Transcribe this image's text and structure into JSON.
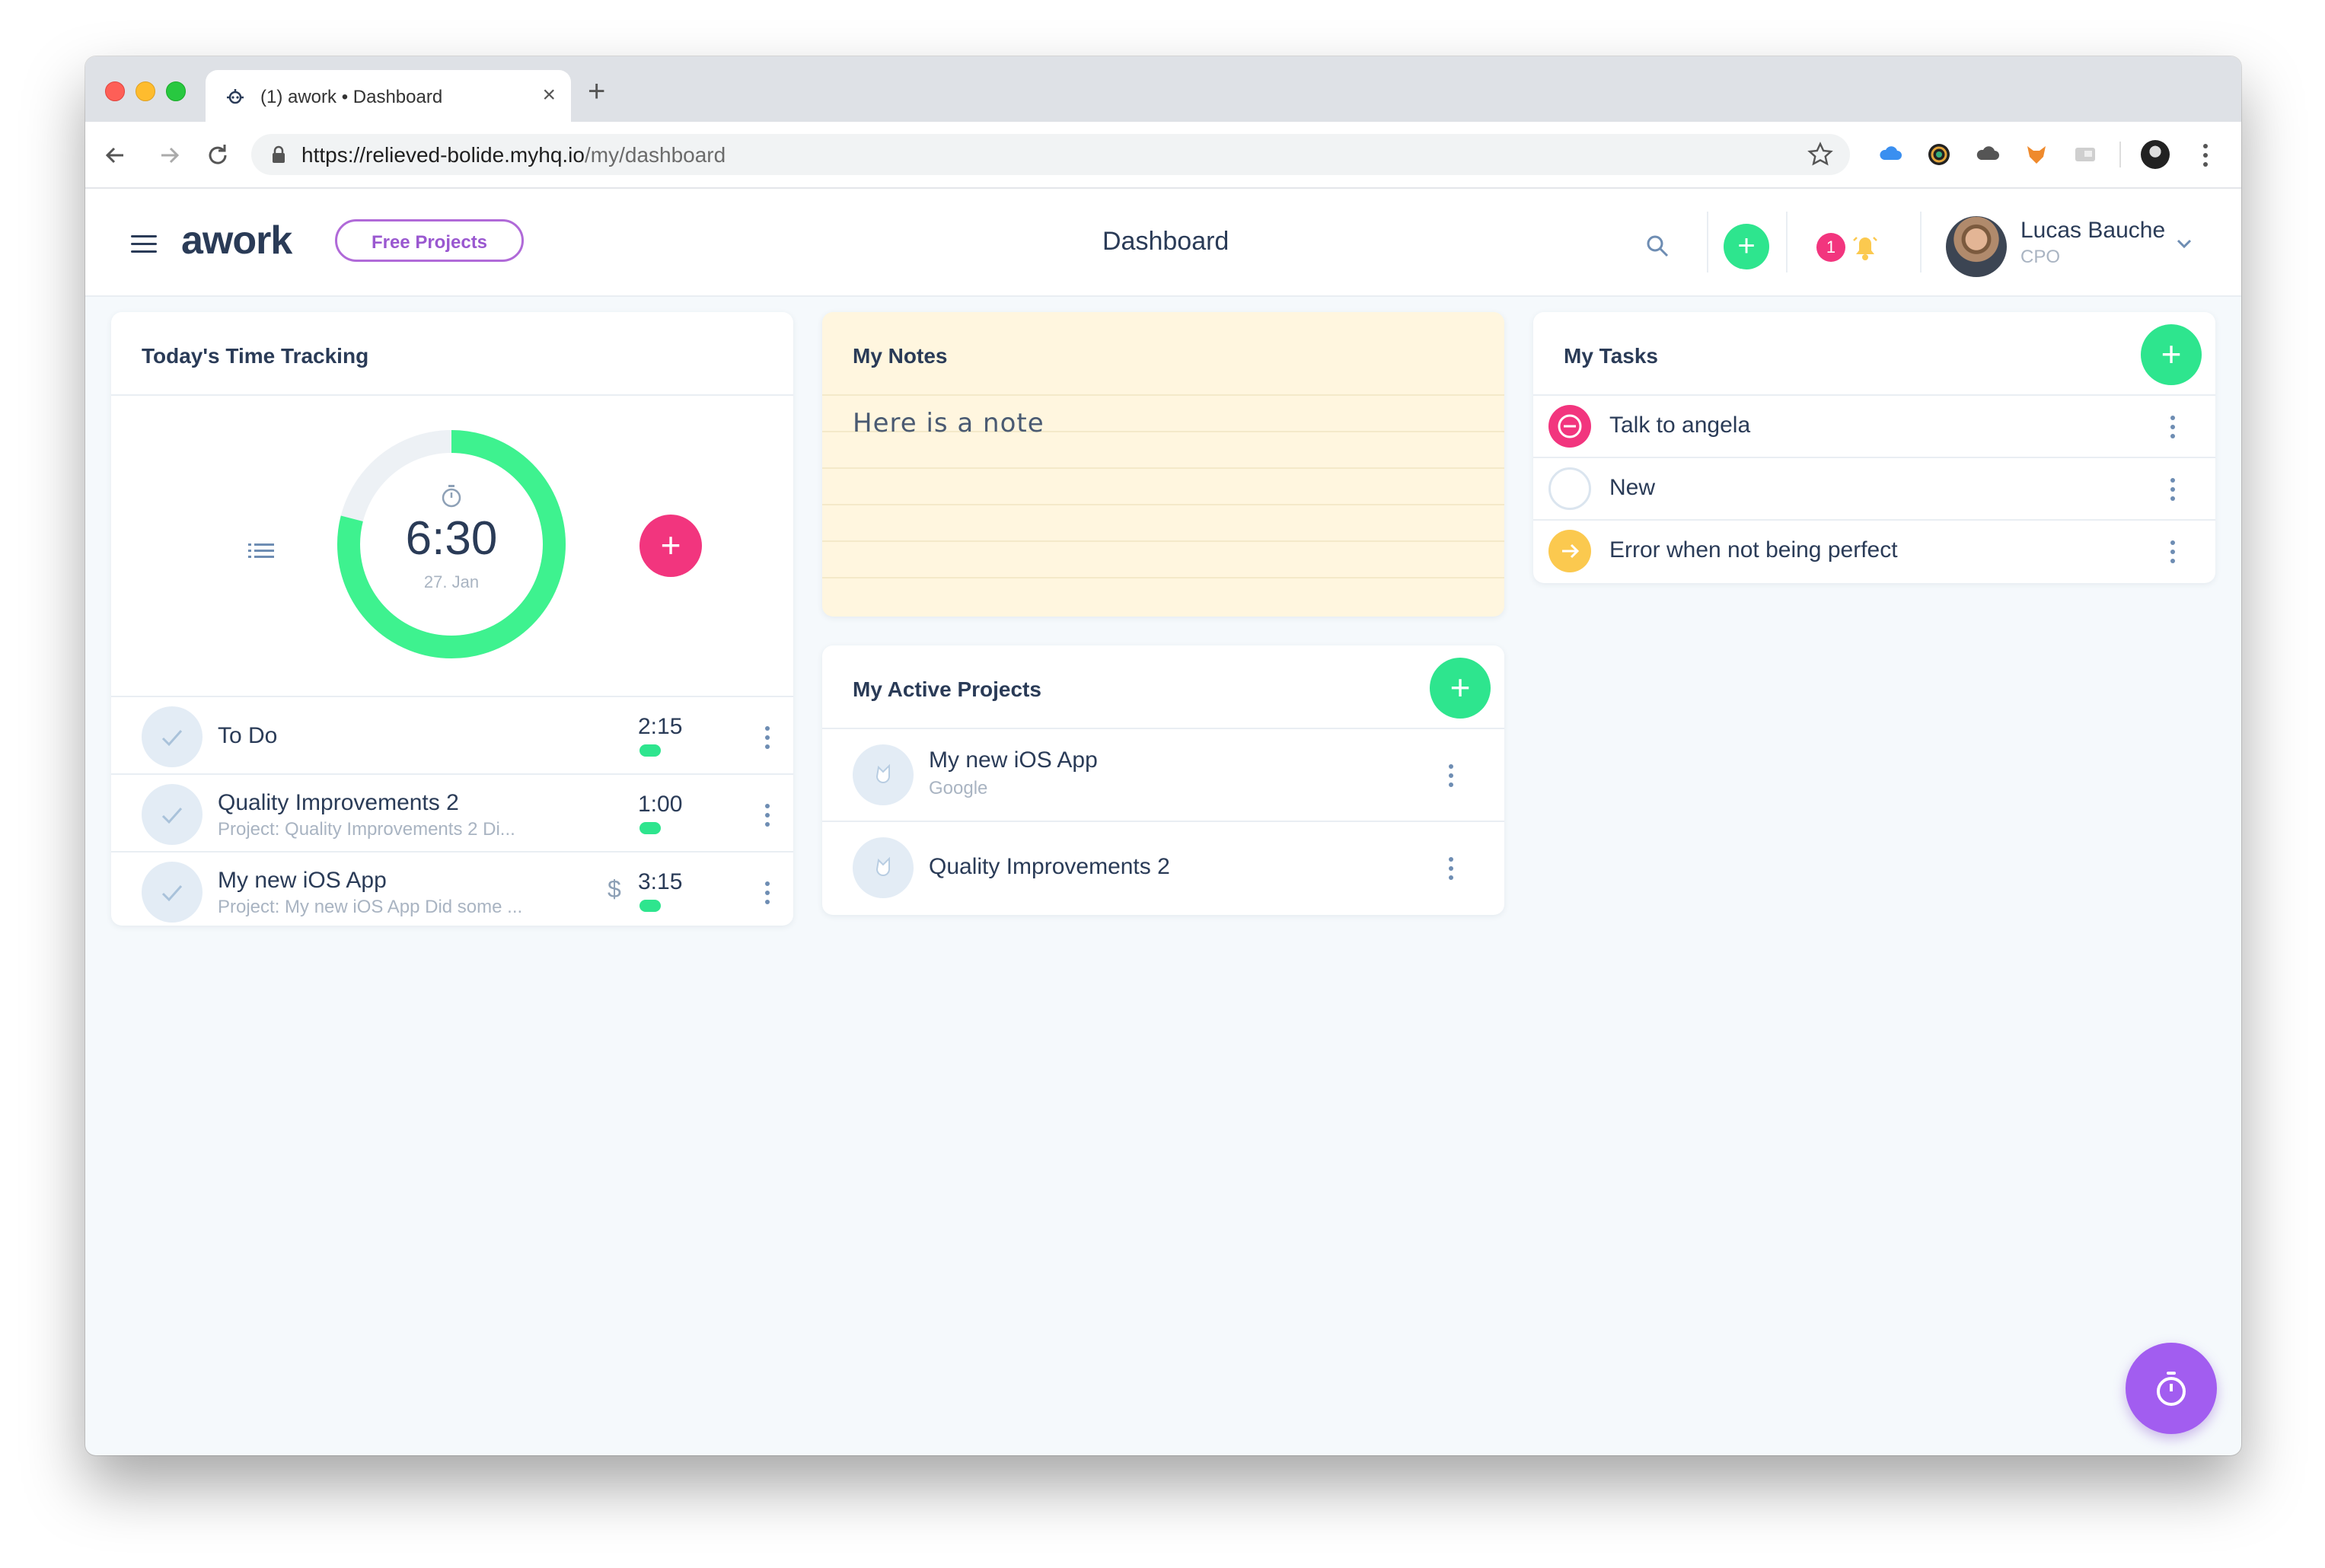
{
  "browser": {
    "tab_title": "(1) awork • Dashboard",
    "new_tab_label": "+",
    "close_tab_label": "×",
    "url_main": "https://relieved-bolide.myhq.io",
    "url_path": "/my/dashboard"
  },
  "header": {
    "logo": "awork",
    "free_projects_label": "Free Projects",
    "page_title": "Dashboard",
    "add_label": "+",
    "notification_count": "1",
    "user_name": "Lucas Bauche",
    "user_role": "CPO"
  },
  "time_tracking": {
    "title": "Today's Time Tracking",
    "total_time": "6:30",
    "date": "27. Jan",
    "add_label": "+",
    "progress_fraction": 0.79,
    "entries": [
      {
        "title": "To Do",
        "subtitle": "",
        "time": "2:15",
        "billable": false
      },
      {
        "title": "Quality Improvements 2",
        "subtitle": "Project: Quality Improvements 2 Di...",
        "time": "1:00",
        "billable": false
      },
      {
        "title": "My new iOS App",
        "subtitle": "Project: My new iOS App Did some ...",
        "time": "3:15",
        "billable": true,
        "billable_symbol": "$"
      }
    ]
  },
  "notes": {
    "title": "My Notes",
    "text": "Here is a note"
  },
  "projects": {
    "title": "My Active Projects",
    "add_label": "+",
    "items": [
      {
        "name": "My new iOS App",
        "client": "Google"
      },
      {
        "name": "Quality Improvements 2",
        "client": ""
      }
    ]
  },
  "tasks": {
    "title": "My Tasks",
    "add_label": "+",
    "items": [
      {
        "label": "Talk to angela",
        "status": "blocked"
      },
      {
        "label": "New",
        "status": "new"
      },
      {
        "label": "Error when not being perfect",
        "status": "in-progress"
      }
    ]
  },
  "colors": {
    "accent_green": "#2ee58e",
    "accent_pink": "#f2357e",
    "accent_purple": "#a25df0",
    "status_yellow": "#fbc94f",
    "text_dark": "#2a3b57"
  }
}
